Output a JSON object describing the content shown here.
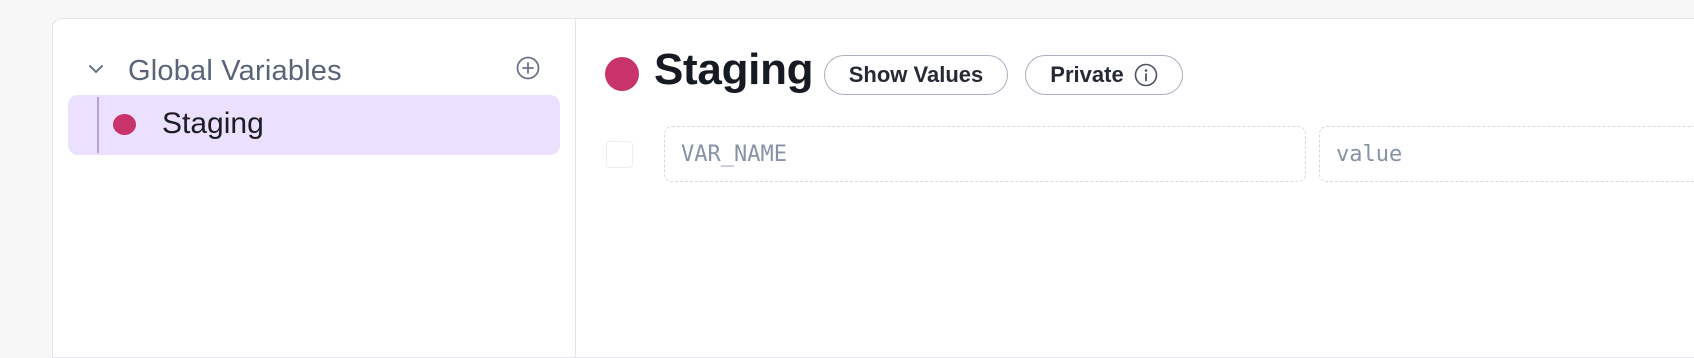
{
  "colors": {
    "environment_dot": "#c8336b",
    "selected_item_bg": "#ebe0fd"
  },
  "sidebar": {
    "title": "Global Variables",
    "items": [
      {
        "label": "Staging"
      }
    ]
  },
  "main": {
    "environment_title": "Staging",
    "show_values_label": "Show Values",
    "private_label": "Private"
  },
  "variable_row": {
    "name_placeholder": "VAR_NAME",
    "value_placeholder": "value"
  }
}
